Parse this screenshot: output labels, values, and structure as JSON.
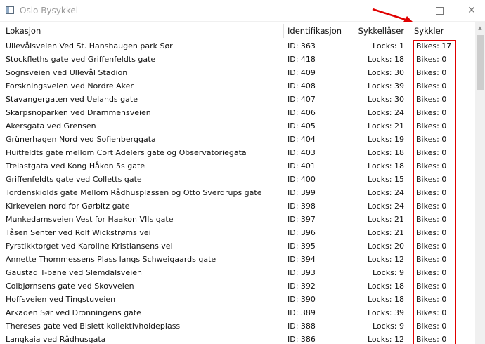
{
  "window": {
    "title": "Oslo Bysykkel",
    "app_icon": "window-app-icon",
    "controls": {
      "minimize_icon": "minimize-icon",
      "maximize_icon": "maximize-icon",
      "close_icon": "close-icon",
      "close_glyph": "✕"
    }
  },
  "table": {
    "columns": [
      "Lokasjon",
      "Identifikasjon",
      "Sykkellåser",
      "Sykkler"
    ],
    "rows": [
      {
        "location": "Ullevålsveien Ved St. Hanshaugen park Sør",
        "id": "ID: 363",
        "locks": "Locks: 1",
        "bikes": "Bikes: 17"
      },
      {
        "location": "Stockfleths gate ved Griffenfeldts gate",
        "id": "ID: 418",
        "locks": "Locks: 18",
        "bikes": "Bikes: 0"
      },
      {
        "location": "Sognsveien ved Ullevål Stadion",
        "id": "ID: 409",
        "locks": "Locks: 30",
        "bikes": "Bikes: 0"
      },
      {
        "location": "Forskningsveien ved Nordre Aker",
        "id": "ID: 408",
        "locks": "Locks: 39",
        "bikes": "Bikes: 0"
      },
      {
        "location": "Stavangergaten ved Uelands gate",
        "id": "ID: 407",
        "locks": "Locks: 30",
        "bikes": "Bikes: 0"
      },
      {
        "location": "Skarpsnoparken ved Drammensveien",
        "id": "ID: 406",
        "locks": "Locks: 24",
        "bikes": "Bikes: 0"
      },
      {
        "location": "Akersgata ved Grensen",
        "id": "ID: 405",
        "locks": "Locks: 21",
        "bikes": "Bikes: 0"
      },
      {
        "location": "Grünerhagen Nord ved Sofienberggata",
        "id": "ID: 404",
        "locks": "Locks: 19",
        "bikes": "Bikes: 0"
      },
      {
        "location": "Huitfeldts gate mellom Cort Adelers gate og Observatoriegata",
        "id": "ID: 403",
        "locks": "Locks: 18",
        "bikes": "Bikes: 0"
      },
      {
        "location": "Trelastgata ved Kong Håkon 5s gate",
        "id": "ID: 401",
        "locks": "Locks: 18",
        "bikes": "Bikes: 0"
      },
      {
        "location": "Griffenfeldts gate ved Colletts gate",
        "id": "ID: 400",
        "locks": "Locks: 15",
        "bikes": "Bikes: 0"
      },
      {
        "location": "Tordenskiolds gate Mellom Rådhusplassen og Otto Sverdrups gate",
        "id": "ID: 399",
        "locks": "Locks: 24",
        "bikes": "Bikes: 0"
      },
      {
        "location": "Kirkeveien nord for Gørbitz gate",
        "id": "ID: 398",
        "locks": "Locks: 24",
        "bikes": "Bikes: 0"
      },
      {
        "location": "Munkedamsveien Vest for Haakon VIIs gate",
        "id": "ID: 397",
        "locks": "Locks: 21",
        "bikes": "Bikes: 0"
      },
      {
        "location": "Tåsen Senter ved Rolf Wickstrøms vei",
        "id": "ID: 396",
        "locks": "Locks: 21",
        "bikes": "Bikes: 0"
      },
      {
        "location": "Fyrstikktorget ved Karoline Kristiansens vei",
        "id": "ID: 395",
        "locks": "Locks: 20",
        "bikes": "Bikes: 0"
      },
      {
        "location": "Annette Thommessens Plass langs Schweigaards gate",
        "id": "ID: 394",
        "locks": "Locks: 12",
        "bikes": "Bikes: 0"
      },
      {
        "location": "Gaustad T-bane ved Slemdalsveien",
        "id": "ID: 393",
        "locks": "Locks: 9",
        "bikes": "Bikes: 0"
      },
      {
        "location": "Colbjørnsens gate ved Skovveien",
        "id": "ID: 392",
        "locks": "Locks: 18",
        "bikes": "Bikes: 0"
      },
      {
        "location": "Hoffsveien ved Tingstuveien",
        "id": "ID: 390",
        "locks": "Locks: 18",
        "bikes": "Bikes: 0"
      },
      {
        "location": "Arkaden Sør ved Dronningens gate",
        "id": "ID: 389",
        "locks": "Locks: 39",
        "bikes": "Bikes: 0"
      },
      {
        "location": "Thereses gate ved Bislett kollektivholdeplass",
        "id": "ID: 388",
        "locks": "Locks: 9",
        "bikes": "Bikes: 0"
      },
      {
        "location": "Langkaia ved Rådhusgata",
        "id": "ID: 386",
        "locks": "Locks: 12",
        "bikes": "Bikes: 0"
      }
    ]
  },
  "annotation": {
    "color": "#e00000"
  },
  "scrollbar": {
    "up_icon": "scroll-up-arrow-icon",
    "up_glyph": "▲"
  }
}
